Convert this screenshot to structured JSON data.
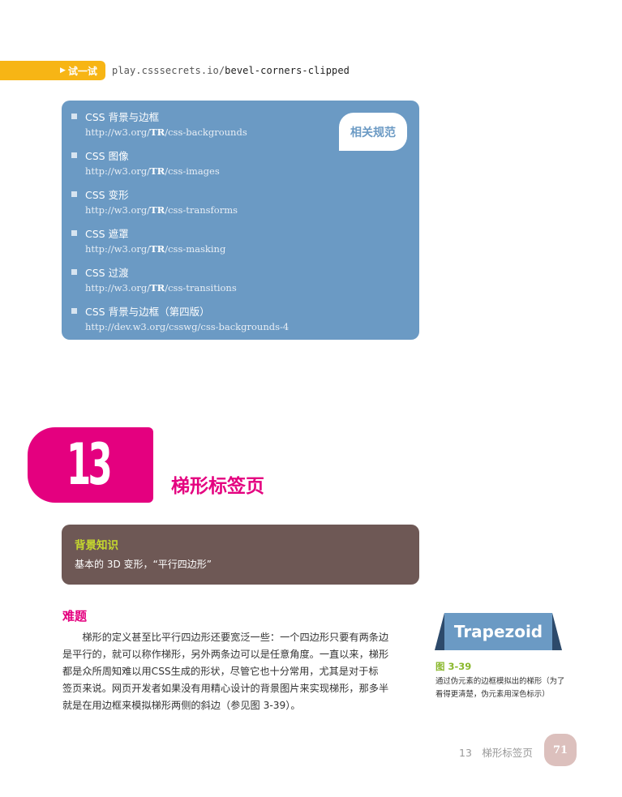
{
  "try_it": {
    "label": "试一试",
    "url_prefix": "play.csssecrets.io/",
    "url_path": "bevel-corners-clipped"
  },
  "specs": {
    "badge": "相关规范",
    "items": [
      {
        "title": "CSS 背景与边框",
        "url_pre": "http://w3.org/",
        "url_bold": "TR",
        "url_post": "/css-backgrounds"
      },
      {
        "title": "CSS 图像",
        "url_pre": "http://w3.org/",
        "url_bold": "TR",
        "url_post": "/css-images"
      },
      {
        "title": "CSS 变形",
        "url_pre": "http://w3.org/",
        "url_bold": "TR",
        "url_post": "/css-transforms"
      },
      {
        "title": "CSS 遮罩",
        "url_pre": "http://w3.org/",
        "url_bold": "TR",
        "url_post": "/css-masking"
      },
      {
        "title": "CSS 过渡",
        "url_pre": "http://w3.org/",
        "url_bold": "TR",
        "url_post": "/css-transitions"
      },
      {
        "title": "CSS 背景与边框（第四版）",
        "url_pre": "http://dev.w3.org/csswg/css-backgrounds-4",
        "url_bold": "",
        "url_post": ""
      }
    ]
  },
  "chapter": {
    "number": "13",
    "title": "梯形标签页"
  },
  "background": {
    "label": "背景知识",
    "text": "基本的 3D 变形，“平行四边形”"
  },
  "problem": {
    "title": "难题",
    "lines": [
      "　　梯形的定义甚至比平行四边形还要宽泛一些：一个四边形只要有两条边",
      "是平行的，就可以称作梯形，另外两条边可以是任意角度。一直以来，梯形",
      "都是众所周知难以用CSS生成的形状，尽管它也十分常用，尤其是对于标",
      "签页来说。网页开发者如果没有用精心设计的背景图片来实现梯形，那多半",
      "就是在用边框来模拟梯形两侧的斜边（参见图 3-39）。"
    ]
  },
  "figure": {
    "label": "Trapezoid",
    "number": "图 3-39",
    "caption": "通过伪元素的边框模拟出的梯形（为了看得更清楚，伪元素用深色标示）"
  },
  "footer": {
    "chapter_ref": "13　梯形标签页",
    "page": "71"
  }
}
